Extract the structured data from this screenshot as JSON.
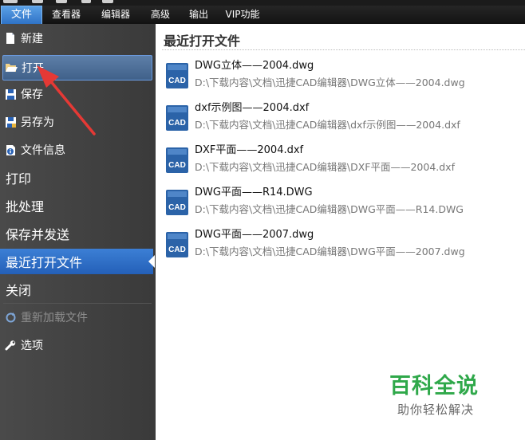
{
  "menubar": {
    "tabs": [
      {
        "label": "文件",
        "active": true
      },
      {
        "label": "查看器",
        "active": false
      },
      {
        "label": "编辑器",
        "active": false
      },
      {
        "label": "高级",
        "active": false
      },
      {
        "label": "输出",
        "active": false
      },
      {
        "label": "VIP功能",
        "active": false
      }
    ]
  },
  "sidebar": {
    "items": [
      {
        "label": "新建",
        "icon": "new-document-icon",
        "state": "normal"
      },
      {
        "label": "打开",
        "icon": "folder-open-icon",
        "state": "hover"
      },
      {
        "label": "保存",
        "icon": "floppy-disk-icon",
        "state": "normal"
      },
      {
        "label": "另存为",
        "icon": "save-as-icon",
        "state": "normal"
      },
      {
        "label": "文件信息",
        "icon": "file-info-icon",
        "state": "normal"
      },
      {
        "label": "打印",
        "icon": null,
        "state": "normal"
      },
      {
        "label": "批处理",
        "icon": null,
        "state": "normal"
      },
      {
        "label": "保存并发送",
        "icon": null,
        "state": "normal"
      },
      {
        "label": "最近打开文件",
        "icon": null,
        "state": "selected"
      },
      {
        "label": "关闭",
        "icon": null,
        "state": "normal"
      },
      {
        "label": "重新加载文件",
        "icon": "reload-icon",
        "state": "disabled"
      },
      {
        "label": "选项",
        "icon": "wrench-icon",
        "state": "normal"
      }
    ]
  },
  "recent": {
    "title": "最近打开文件",
    "files": [
      {
        "name": "DWG立体——2004.dwg",
        "path": "D:\\下载内容\\文档\\迅捷CAD编辑器\\DWG立体——2004.dwg",
        "icon_text": "CAD"
      },
      {
        "name": "dxf示例图——2004.dxf",
        "path": "D:\\下载内容\\文档\\迅捷CAD编辑器\\dxf示例图——2004.dxf",
        "icon_text": "CAD"
      },
      {
        "name": "DXF平面——2004.dxf",
        "path": "D:\\下载内容\\文档\\迅捷CAD编辑器\\DXF平面——2004.dxf",
        "icon_text": "CAD"
      },
      {
        "name": "DWG平面——R14.DWG",
        "path": "D:\\下载内容\\文档\\迅捷CAD编辑器\\DWG平面——R14.DWG",
        "icon_text": "CAD"
      },
      {
        "name": "DWG平面——2007.dwg",
        "path": "D:\\下载内容\\文档\\迅捷CAD编辑器\\DWG平面——2007.dwg",
        "icon_text": "CAD"
      }
    ]
  },
  "watermark": {
    "title": "百科全说",
    "subtitle": "助你轻松解决"
  },
  "colors": {
    "accent": "#2f73c6",
    "sidebar_bg": "#404040",
    "watermark_green": "#2fa84a",
    "annotation_arrow": "#e53935"
  }
}
